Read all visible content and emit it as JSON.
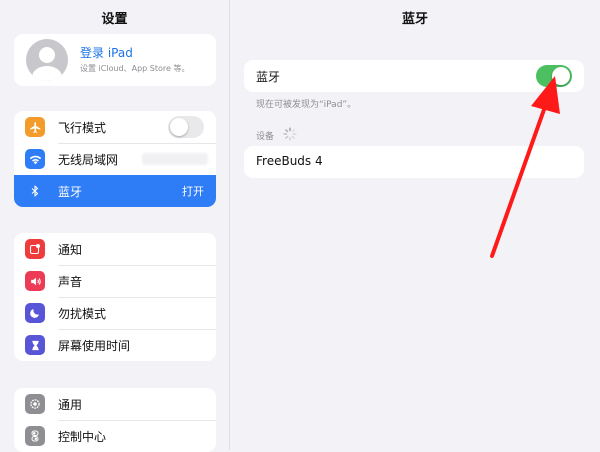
{
  "left": {
    "title": "设置",
    "profile": {
      "name": "登录 iPad",
      "subtitle": "设置 iCloud、App Store 等。"
    },
    "group1": [
      {
        "label": "飞行模式",
        "icon": "airplane-icon",
        "color": "#f39c2b",
        "control": "toggle-off"
      },
      {
        "label": "无线局域网",
        "icon": "wifi-icon",
        "color": "#2e7cf6",
        "control": "blurred"
      },
      {
        "label": "蓝牙",
        "icon": "bluetooth-icon",
        "color": "#2e7cf6",
        "value": "打开",
        "selected": true
      }
    ],
    "group2": [
      {
        "label": "通知",
        "icon": "notification-icon",
        "color": "#ee3b3b"
      },
      {
        "label": "声音",
        "icon": "speaker-icon",
        "color": "#ee3b55"
      },
      {
        "label": "勿扰模式",
        "icon": "moon-icon",
        "color": "#5856d6"
      },
      {
        "label": "屏幕使用时间",
        "icon": "hourglass-icon",
        "color": "#5856d6"
      }
    ],
    "group3": [
      {
        "label": "通用",
        "icon": "gear-icon",
        "color": "#8e8e93"
      },
      {
        "label": "控制中心",
        "icon": "control-center-icon",
        "color": "#8e8e93"
      }
    ]
  },
  "right": {
    "title": "蓝牙",
    "bluetooth_label": "蓝牙",
    "bluetooth_on": true,
    "discoverable_hint": "现在可被发现为“iPad”。",
    "devices_header": "设备",
    "devices": [
      {
        "name": "FreeBuds 4"
      }
    ]
  },
  "colors": {
    "accent": "#2e7cf6",
    "toggle_on": "#4cbf61",
    "annotation_arrow": "#ff1a1a"
  }
}
